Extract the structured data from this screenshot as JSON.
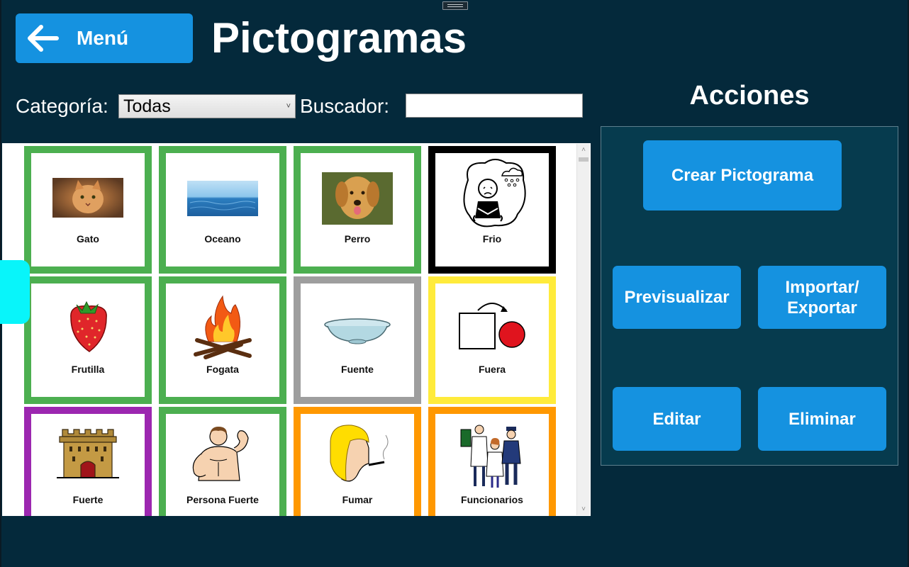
{
  "header": {
    "menu_label": "Menú",
    "title": "Pictogramas"
  },
  "filters": {
    "category_label": "Categoría:",
    "category_value": "Todas",
    "search_label": "Buscador:",
    "search_value": ""
  },
  "pictograms": [
    {
      "name": "Gato",
      "border": "#4caf50",
      "icon": "cat-photo"
    },
    {
      "name": "Oceano",
      "border": "#4caf50",
      "icon": "ocean-photo"
    },
    {
      "name": "Perro",
      "border": "#4caf50",
      "icon": "dog-photo"
    },
    {
      "name": "Frio",
      "border": "#000000",
      "icon": "cold-person-icon"
    },
    {
      "name": "Frutilla",
      "border": "#4caf50",
      "icon": "strawberry-icon"
    },
    {
      "name": "Fogata",
      "border": "#4caf50",
      "icon": "campfire-icon"
    },
    {
      "name": "Fuente",
      "border": "#9e9e9e",
      "icon": "bowl-icon"
    },
    {
      "name": "Fuera",
      "border": "#ffeb3b",
      "icon": "outside-icon"
    },
    {
      "name": "Fuerte",
      "border": "#9c27b0",
      "icon": "castle-icon"
    },
    {
      "name": "Persona Fuerte",
      "border": "#4caf50",
      "icon": "strong-person-icon"
    },
    {
      "name": "Fumar",
      "border": "#ff9800",
      "icon": "smoking-icon"
    },
    {
      "name": "Funcionarios",
      "border": "#ff9800",
      "icon": "officials-icon"
    }
  ],
  "actions": {
    "title": "Acciones",
    "create": "Crear Pictograma",
    "preview": "Previsualizar",
    "import_export_line1": "Importar/",
    "import_export_line2": "Exportar",
    "edit": "Editar",
    "delete": "Eliminar"
  },
  "colors": {
    "background": "#04293b",
    "button": "#1592e0",
    "panel": "#063b4e",
    "side_tab": "#08f5fa"
  }
}
